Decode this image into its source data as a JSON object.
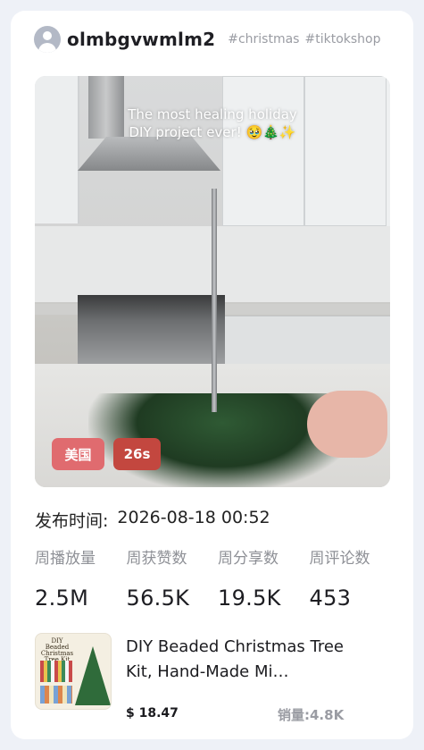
{
  "header": {
    "username": "olmbgvwmlm2",
    "hashtags": [
      "#christmas",
      "#tiktokshop"
    ]
  },
  "video": {
    "overlay_line1": "The most healing holiday",
    "overlay_line2": "DIY project ever! 🥹🎄✨",
    "country_badge": "美国",
    "duration_badge": "26s"
  },
  "publish": {
    "label": "发布时间:",
    "value": "2026-08-18 00:52"
  },
  "stats": [
    {
      "label": "周播放量",
      "value": "2.5M"
    },
    {
      "label": "周获赞数",
      "value": "56.5K"
    },
    {
      "label": "周分享数",
      "value": "19.5K"
    },
    {
      "label": "周评论数",
      "value": "453"
    }
  ],
  "product": {
    "thumb_title": "DIY Beaded Christmas Tree Kit",
    "title": "DIY Beaded Christmas Tree Kit, Hand-Made Mi…",
    "price": "$ 18.47",
    "sales": "销量:4.8K"
  },
  "colors": {
    "country_badge": "#e06b6f",
    "duration_badge": "#c3473f",
    "background": "#eef1f7"
  }
}
